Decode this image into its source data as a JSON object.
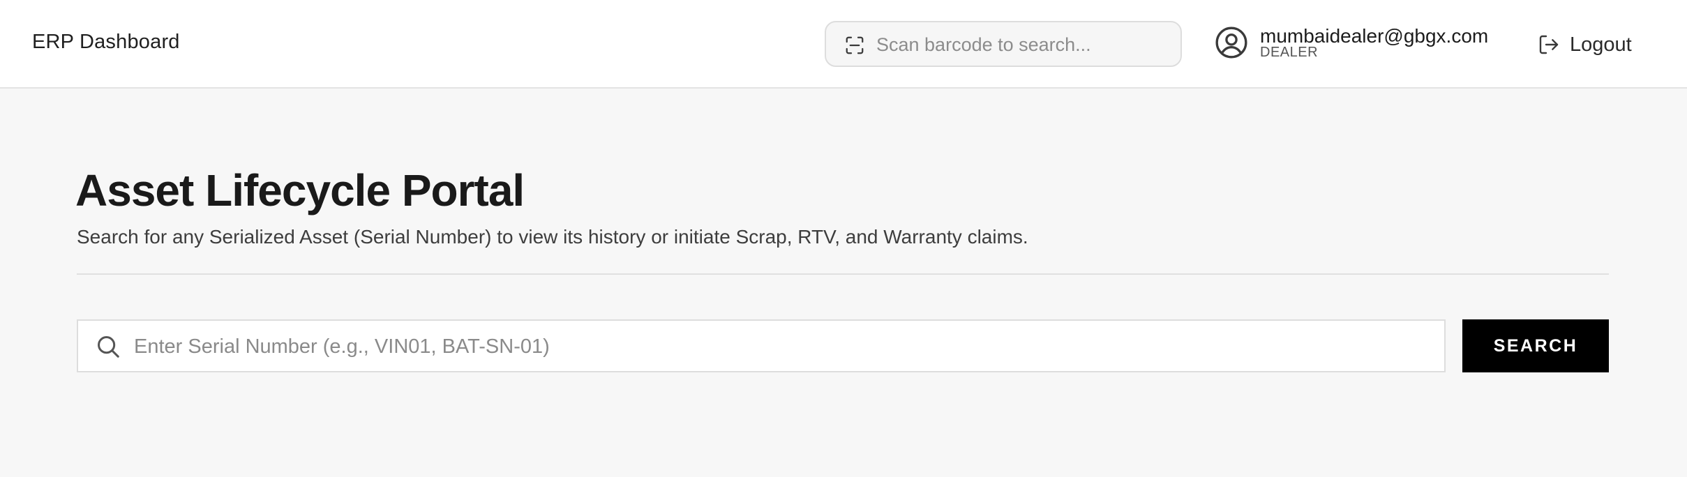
{
  "header": {
    "brand": "ERP Dashboard",
    "scan_search": {
      "placeholder": "Scan barcode to search...",
      "icon": "barcode-scan-icon"
    },
    "user": {
      "email": "mumbaidealer@gbgx.com",
      "role": "DEALER",
      "icon": "user-circle-icon"
    },
    "logout": {
      "label": "Logout",
      "icon": "logout-icon"
    }
  },
  "main": {
    "title": "Asset Lifecycle Portal",
    "subtitle": "Search for any Serialized Asset (Serial Number) to view its history or initiate Scrap, RTV, and Warranty claims.",
    "serial_search": {
      "placeholder": "Enter Serial Number (e.g., VIN01, BAT-SN-01)",
      "value": "",
      "icon": "search-icon"
    },
    "search_button": "SEARCH"
  },
  "colors": {
    "page_background": "#f7f7f7",
    "header_background": "#ffffff",
    "primary_button": "#000000",
    "primary_button_text": "#ffffff",
    "border": "#dddddd"
  }
}
